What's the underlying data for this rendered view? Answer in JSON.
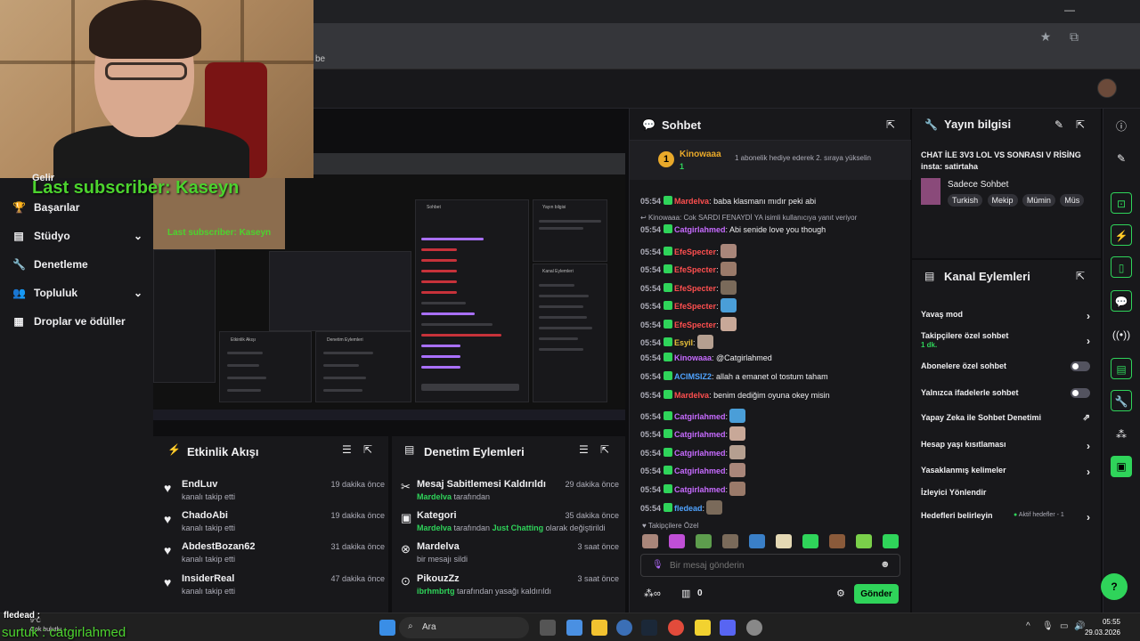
{
  "browser": {
    "bookmark_text": "be"
  },
  "left_nav": {
    "items": [
      {
        "label": "Başarılar",
        "icon": "trophy-icon"
      },
      {
        "label": "Stüdyo",
        "icon": "studio-icon"
      },
      {
        "label": "Denetleme",
        "icon": "wrench-icon"
      },
      {
        "label": "Topluluk",
        "icon": "community-icon"
      },
      {
        "label": "Droplar ve ödüller",
        "icon": "gift-icon"
      }
    ],
    "partial_item": "Gelir"
  },
  "overlay": {
    "last_subscriber": "Last subscriber: Kaseyn",
    "bottom_follower": "fledead :",
    "bottom_ticker": "surtuk : catgirlahmed",
    "weather_temp": "9°C",
    "weather_desc": "Çok bulutlu"
  },
  "activity_feed": {
    "title": "Etkinlik Akışı",
    "items": [
      {
        "name": "EndLuv",
        "desc": "kanalı takip etti",
        "time": "19 dakika önce"
      },
      {
        "name": "ChadoAbi",
        "desc": "kanalı takip etti",
        "time": "19 dakika önce"
      },
      {
        "name": "AbdestBozan62",
        "desc": "kanalı takip etti",
        "time": "31 dakika önce"
      },
      {
        "name": "InsiderReal",
        "desc": "kanalı takip etti",
        "time": "47 dakika önce"
      }
    ]
  },
  "mod_actions": {
    "title": "Denetim Eylemleri",
    "items": [
      {
        "name": "Mesaj Sabitlemesi Kaldırıldı",
        "actor": "Mardelva",
        "desc": " tarafından",
        "extra": "",
        "time": "29 dakika önce"
      },
      {
        "name": "Kategori",
        "actor": "Mardelva",
        "desc": " tarafından ",
        "extra": "Just Chatting",
        "tail": " olarak değiştirildi",
        "time": "35 dakika önce"
      },
      {
        "name": "Mardelva",
        "actor": "",
        "desc": "bir mesajı sildi",
        "extra": "",
        "time": "3 saat önce"
      },
      {
        "name": "PikouzZz",
        "actor": "ibrhmbrtg",
        "desc": " tarafından yasağı kaldırıldı",
        "extra": "",
        "time": "3 saat önce"
      }
    ]
  },
  "chat": {
    "title": "Sohbet",
    "pinned": {
      "name": "Kinowaaa",
      "count": "1",
      "text": "1 abonelik hediye ederek 2. sıraya yükselin"
    },
    "messages": [
      {
        "ts": "05:54",
        "name": "Mardelva",
        "color": "#ff4f4f",
        "text": ": baba klasmanı mıdır peki abi"
      },
      {
        "ts": "05:54",
        "name": "Catgirlahmed",
        "color": "#c76bff",
        "text": ": Abi senide love you though"
      },
      {
        "ts": "05:54",
        "name": "EfeSpecter",
        "color": "#ff4f4f",
        "text": ":"
      },
      {
        "ts": "05:54",
        "name": "EfeSpecter",
        "color": "#ff4f4f",
        "text": ":"
      },
      {
        "ts": "05:54",
        "name": "EfeSpecter",
        "color": "#ff4f4f",
        "text": ":"
      },
      {
        "ts": "05:54",
        "name": "EfeSpecter",
        "color": "#ff4f4f",
        "text": ":"
      },
      {
        "ts": "05:54",
        "name": "EfeSpecter",
        "color": "#ff4f4f",
        "text": ":"
      },
      {
        "ts": "05:54",
        "name": "Esyil",
        "color": "#e9c13a",
        "text": ":"
      },
      {
        "ts": "05:54",
        "name": "Kinowaaa",
        "color": "#c76bff",
        "text": ": @Catgirlahmed"
      },
      {
        "ts": "05:54",
        "name": "ACIMSIZ2",
        "color": "#4fa3ff",
        "text": ": allah a emanet ol tostum taham"
      },
      {
        "ts": "05:54",
        "name": "Mardelva",
        "color": "#ff4f4f",
        "text": ": benim dediğim oyuna okey misin"
      },
      {
        "ts": "05:54",
        "name": "Catgirlahmed",
        "color": "#c76bff",
        "text": ":"
      },
      {
        "ts": "05:54",
        "name": "Catgirlahmed",
        "color": "#c76bff",
        "text": ":"
      },
      {
        "ts": "05:54",
        "name": "Catgirlahmed",
        "color": "#c76bff",
        "text": ":"
      },
      {
        "ts": "05:54",
        "name": "Catgirlahmed",
        "color": "#c76bff",
        "text": ":"
      },
      {
        "ts": "05:54",
        "name": "Catgirlahmed",
        "color": "#c76bff",
        "text": ":"
      },
      {
        "ts": "05:54",
        "name": "fledead",
        "color": "#4fa3ff",
        "text": ":"
      }
    ],
    "reply": "Kinowaaa: Cok SARDI FENAYDİ YA",
    "reply_tail": "isimli kullanıcıya yanıt veriyor",
    "follower_only": "Takipçilere Özel",
    "input_placeholder": "Bir mesaj gönderin",
    "points": "0",
    "send_label": "Gönder"
  },
  "stream_info": {
    "title": "Yayın bilgisi",
    "stream_title": "CHAT İLE 3V3 LOL VS SONRASI V RİSİNG insta: satirtaha",
    "category": "Sadece Sohbet",
    "tags": [
      "Turkish",
      "Mekip",
      "Mümin",
      "Müs"
    ]
  },
  "channel_actions": {
    "title": "Kanal Eylemleri",
    "items": [
      {
        "label": "Yavaş mod",
        "control": "chevron"
      },
      {
        "label": "Takipçilere özel sohbet",
        "sub": "1 dk.",
        "control": "chevron"
      },
      {
        "label": "Abonelere özel sohbet",
        "control": "toggle"
      },
      {
        "label": "Yalnızca ifadelerle sohbet",
        "control": "toggle"
      },
      {
        "label": "Yapay Zeka ile Sohbet Denetimi",
        "control": "external"
      },
      {
        "label": "Hesap yaşı kısıtlaması",
        "control": "chevron"
      },
      {
        "label": "Yasaklanmış kelimeler",
        "control": "chevron"
      },
      {
        "label": "İzleyici Yönlendir",
        "control": "none"
      },
      {
        "label": "Hedefleri belirleyin",
        "extra": "Aktif hedefler - 1",
        "control": "chevron"
      }
    ]
  },
  "taskbar": {
    "search": "Ara",
    "time": "05:55",
    "date": "29.03.2026"
  },
  "preview_text": {
    "sohbet": "Sohbet",
    "yayin": "Yayın bilgisi",
    "kanal": "Kanal Eylemleri",
    "etkinlik": "Etkinlik Akışı",
    "denetim": "Denetim Eylemleri",
    "sub": "Last subscriber: Kaseyn",
    "ticker": "surtuk : catgirlahmed"
  }
}
